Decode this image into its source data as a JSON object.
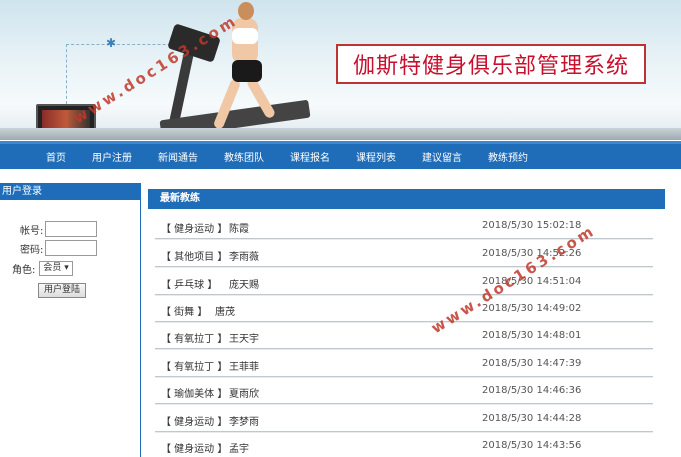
{
  "banner": {
    "title": "伽斯特健身俱乐部管理系统"
  },
  "nav": {
    "items": [
      "首页",
      "用户注册",
      "新闻通告",
      "教练团队",
      "课程报名",
      "课程列表",
      "建议留言",
      "教练预约"
    ]
  },
  "login": {
    "header": "用户登录",
    "account_label": "帐号:",
    "account_value": "",
    "password_label": "密码:",
    "password_value": "",
    "role_label": "角色:",
    "role_selected": "会员",
    "submit_label": "用户登陆"
  },
  "coaches": {
    "header": "最新教练",
    "rows": [
      {
        "category": "【 健身运动 】",
        "name": "陈霞",
        "date": "2018/5/30 15:02:18"
      },
      {
        "category": "【 其他项目 】",
        "name": "李雨薇",
        "date": "2018/5/30 14:52:26"
      },
      {
        "category": "【 乒乓球 】",
        "name": "庞天赐",
        "date": "2018/5/30 14:51:04"
      },
      {
        "category": "【 街舞 】",
        "name": "唐茂",
        "date": "2018/5/30 14:49:02"
      },
      {
        "category": "【 有氧拉丁 】",
        "name": "王天宇",
        "date": "2018/5/30 14:48:01"
      },
      {
        "category": "【 有氧拉丁 】",
        "name": "王菲菲",
        "date": "2018/5/30 14:47:39"
      },
      {
        "category": "【 瑜伽美体 】",
        "name": "夏雨欣",
        "date": "2018/5/30 14:46:36"
      },
      {
        "category": "【 健身运动 】",
        "name": "李梦雨",
        "date": "2018/5/30 14:44:28"
      },
      {
        "category": "【 健身运动 】",
        "name": "孟宇",
        "date": "2018/5/30 14:43:56"
      }
    ]
  },
  "watermark": {
    "text": "www.doc163.com"
  },
  "colors": {
    "nav_blue": "#1f6db8",
    "title_red": "#c8102e"
  }
}
